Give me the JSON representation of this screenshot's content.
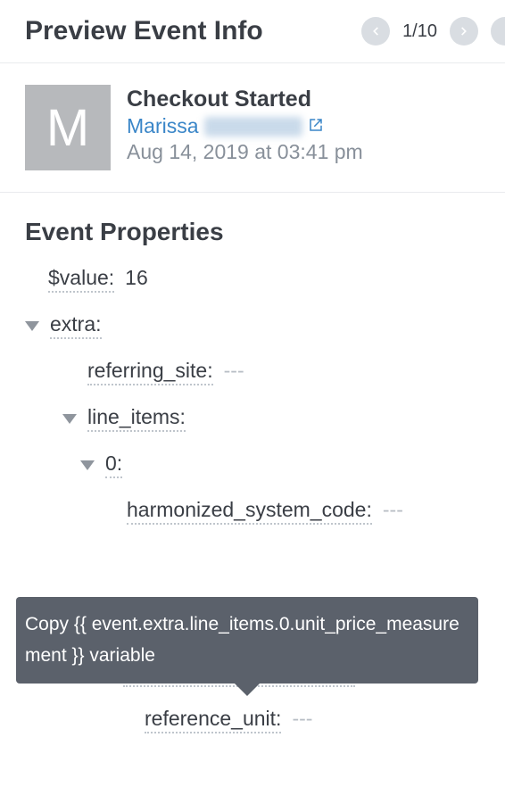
{
  "header": {
    "title": "Preview Event Info",
    "pager_count": "1/10"
  },
  "event": {
    "avatar_initial": "M",
    "name": "Checkout Started",
    "user_first": "Marissa",
    "timestamp": "Aug 14, 2019 at 03:41 pm"
  },
  "props_title": "Event Properties",
  "props": {
    "value_key": "$value:",
    "value_val": "16",
    "extra_key": "extra:",
    "referring_site_key": "referring_site:",
    "referring_site_val": "---",
    "line_items_key": "line_items:",
    "zero_key": "0:",
    "hsc_key": "harmonized_system_code:",
    "hsc_val": "---",
    "upm_key": "unit_price_measurement:",
    "ref_unit_key": "reference_unit:",
    "ref_unit_val": "---"
  },
  "tooltip": {
    "text": "Copy {{ event.extra.line_items.0.unit_price_measurement }} variable"
  }
}
